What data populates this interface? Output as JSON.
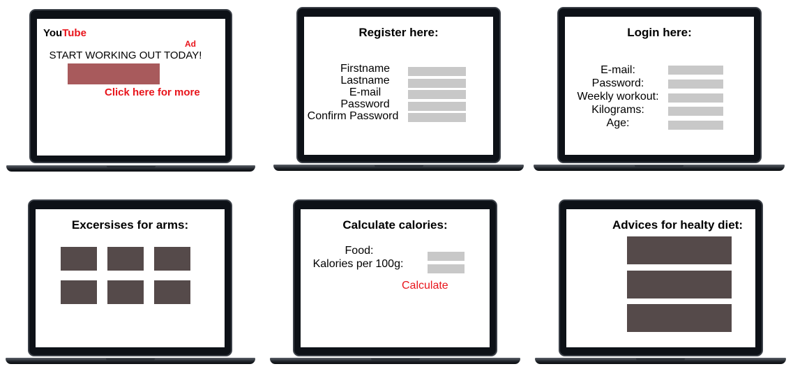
{
  "laptop1": {
    "logo_you": "You",
    "logo_tube": "Tube",
    "ad_label": "Ad",
    "headline": "START WORKING OUT TODAY!",
    "link": "Click here for more",
    "colors": {
      "red": "#e8141b",
      "banner": "#a85a5c"
    }
  },
  "laptop2": {
    "title": "Register here:",
    "fields": [
      "Firstname",
      "Lastname",
      "E-mail",
      "Password",
      "Confirm Password"
    ]
  },
  "laptop3": {
    "title": "Login here:",
    "fields": [
      "E-mail:",
      "Password:",
      "Weekly workout:",
      "Kilograms:",
      "Age:"
    ]
  },
  "laptop4": {
    "title": "Excersises for arms:",
    "tiles": 6
  },
  "laptop5": {
    "title": "Calculate calories:",
    "fields": [
      "Food:",
      "Kalories per 100g:"
    ],
    "button": "Calculate"
  },
  "laptop6": {
    "title": "Advices for healty diet:",
    "cards": 3
  }
}
